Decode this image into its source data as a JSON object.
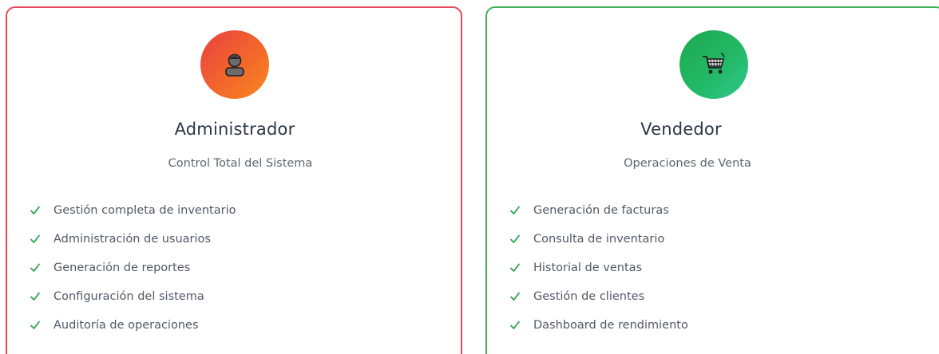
{
  "roles": [
    {
      "title": "Administrador",
      "subtitle": "Control Total del Sistema",
      "icon": "person-icon",
      "accent": "#e24b5d",
      "features": [
        "Gestión completa de inventario",
        "Administración de usuarios",
        "Generación de reportes",
        "Configuración del sistema",
        "Auditoría de operaciones"
      ]
    },
    {
      "title": "Vendedor",
      "subtitle": "Operaciones de Venta",
      "icon": "shopping-cart-icon",
      "accent": "#3fb15a",
      "features": [
        "Generación de facturas",
        "Consulta de inventario",
        "Historial de ventas",
        "Gestión de clientes",
        "Dashboard de rendimiento"
      ]
    }
  ],
  "colors": {
    "check": "#2ea44f",
    "title": "#2b3645",
    "text": "#4f5966"
  }
}
